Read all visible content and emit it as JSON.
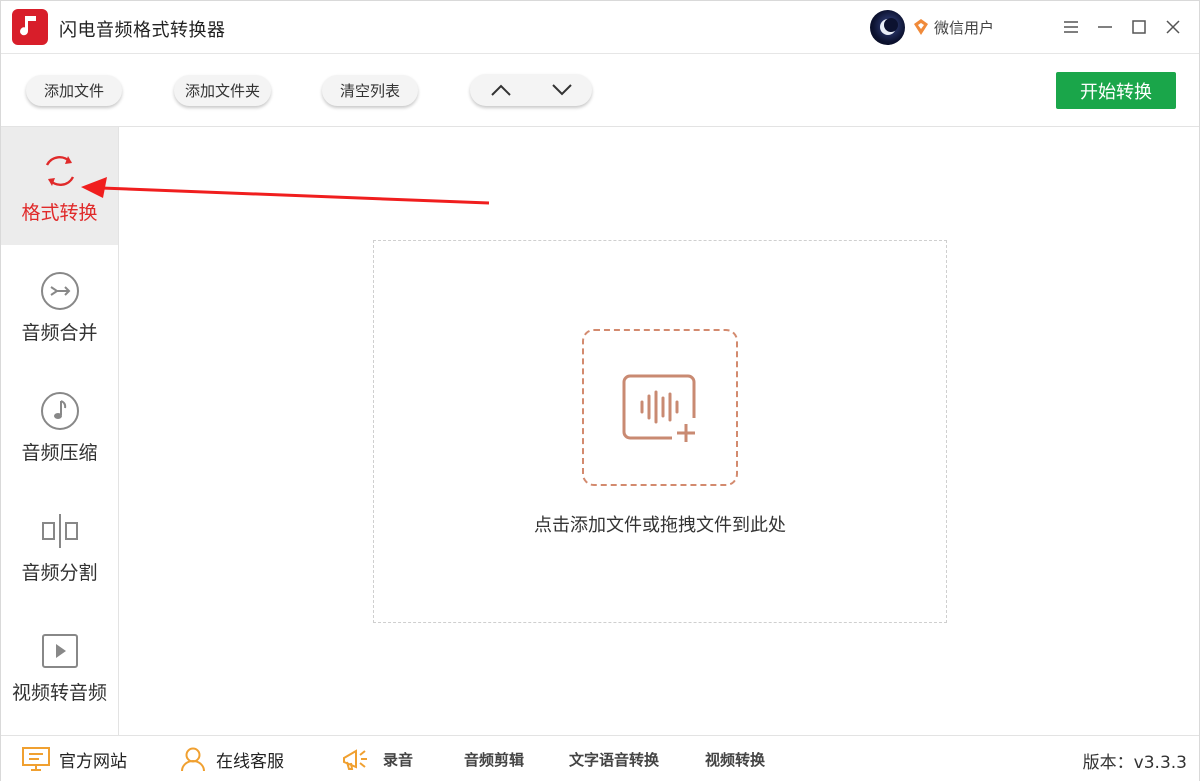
{
  "window": {
    "title": "闪电音频格式转换器",
    "user_name": "微信用户",
    "brand_color": "#d81e2a"
  },
  "toolbar": {
    "add_file": "添加文件",
    "add_folder": "添加文件夹",
    "clear_list": "清空列表",
    "start_convert": "开始转换",
    "accent_color": "#1aa64a"
  },
  "sidebar": {
    "items": [
      {
        "label": "格式转换",
        "icon": "refresh-icon",
        "active": true
      },
      {
        "label": "音频合并",
        "icon": "merge-icon",
        "active": false
      },
      {
        "label": "音频压缩",
        "icon": "music-note-icon",
        "active": false
      },
      {
        "label": "音频分割",
        "icon": "split-icon",
        "active": false
      },
      {
        "label": "视频转音频",
        "icon": "video-play-icon",
        "active": false
      }
    ]
  },
  "main": {
    "drop_hint": "点击添加文件或拖拽文件到此处"
  },
  "bottom": {
    "website": "官方网站",
    "support": "在线客服",
    "record": "录音",
    "audio_edit": "音频剪辑",
    "tts": "文字语音转换",
    "video_convert": "视频转换",
    "version": "版本：v3.3.3"
  }
}
